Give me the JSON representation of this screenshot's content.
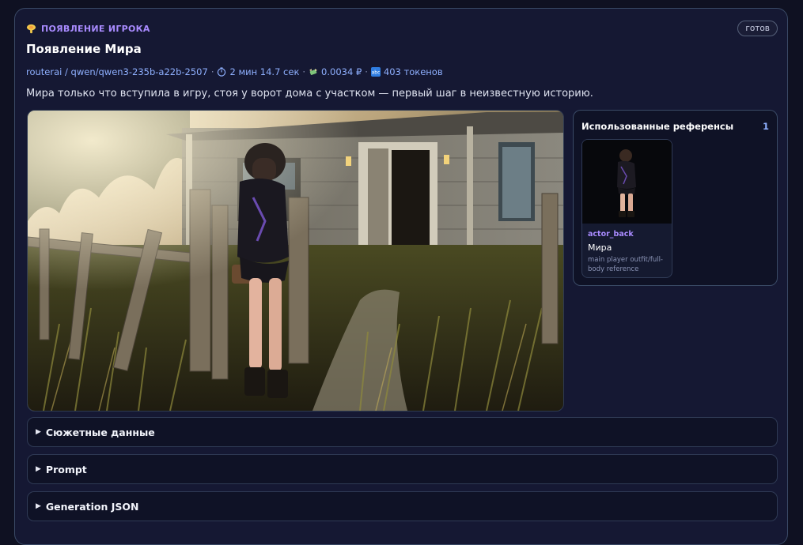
{
  "header": {
    "badge": "ПОЯВЛЕНИЕ ИГРОКА",
    "badge_icon": "mushroom-cloud-icon",
    "status": "готов",
    "title": "Появление Мира",
    "model": "routerai / qwen/qwen3-235b-a22b-2507",
    "duration": "2 мин 14.7 сек",
    "cost": "0.0034 ₽",
    "tokens": "403 токенов",
    "separator": "·"
  },
  "description": "Мира только что вступила в игру, стоя у ворот дома с участком — первый шаг в неизвестную историю.",
  "scene": {
    "image_alt": "girl-at-fence-gate-image"
  },
  "references": {
    "title": "Использованные референсы",
    "count": "1",
    "items": [
      {
        "id": "actor_back",
        "name": "Мира",
        "note": "main player outfit/full-body reference"
      }
    ]
  },
  "sections": [
    {
      "label": "Сюжетные данные"
    },
    {
      "label": "Prompt"
    },
    {
      "label": "Generation JSON"
    }
  ],
  "colors": {
    "accent": "#a98bff",
    "link": "#8fb0ff",
    "card_bg": "#151833",
    "border": "#3a4a66"
  }
}
